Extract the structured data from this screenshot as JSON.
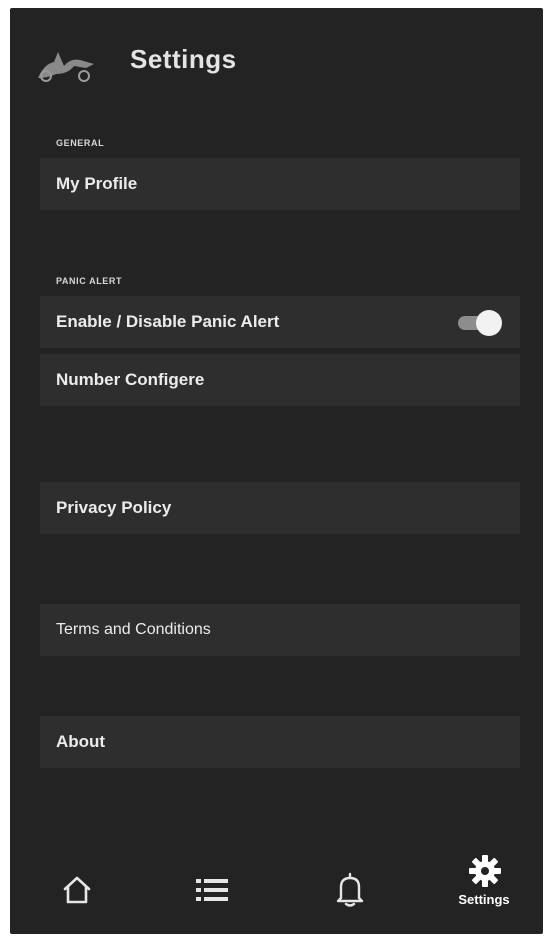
{
  "header": {
    "title": "Settings",
    "logo_icon": "motorcycle-logo-icon"
  },
  "sections": {
    "general": {
      "label": "GENERAL",
      "items": [
        {
          "label": "My Profile"
        }
      ]
    },
    "panic_alert": {
      "label": "PANIC ALERT",
      "items": [
        {
          "label": "Enable / Disable Panic Alert",
          "toggle_on": true
        },
        {
          "label": "Number Configere"
        }
      ]
    },
    "others": {
      "items": [
        {
          "label": "Privacy Policy"
        },
        {
          "label": "Terms and Conditions"
        },
        {
          "label": "About"
        }
      ]
    }
  },
  "bottom_nav": {
    "items": [
      {
        "icon": "home-icon"
      },
      {
        "icon": "list-icon"
      },
      {
        "icon": "bell-icon"
      },
      {
        "icon": "gear-icon",
        "label": "Settings",
        "active": true
      }
    ]
  },
  "colors": {
    "background": "#232323",
    "row": "#2e2e2e",
    "text": "#ececec",
    "toggle_knob": "#f2f2f2"
  }
}
